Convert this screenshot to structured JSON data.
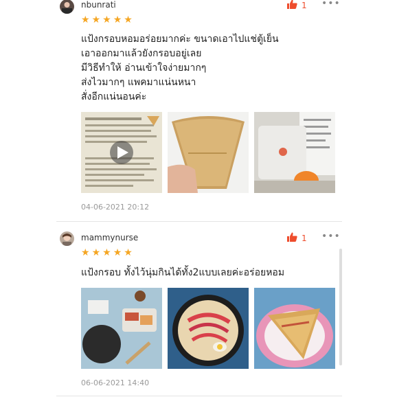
{
  "reviews": [
    {
      "username": "nbunrati",
      "likes": "1",
      "more": "•••",
      "rating": 5,
      "lines": [
        "แป้งกรอบหอมอร่อยมากค่ะ ขนาดเอาไปแช่ตู้เย็น",
        "เอาออกมาแล้วยังกรอบอยู่เลย",
        "มีวิธีทำให้ อ่านเข้าใจง่ายมากๆ",
        "ส่งไวมากๆ แพคมาแน่นหนา",
        "สั่งอีกแน่นอนค่ะ"
      ],
      "media": [
        "video-thumbnail-recipe-sheet",
        "photo-crepe-bag-in-hand",
        "photo-package-with-flyer"
      ],
      "date": "04-06-2021 20:12"
    },
    {
      "username": "mammynurse",
      "likes": "1",
      "more": "•••",
      "rating": 5,
      "lines": [
        "แป้งกรอบ ทั้งไว้นุ่มกินได้ทั้ง2แบบเลยค่ะอร่อยหอม"
      ],
      "media": [
        "photo-cooking-setup",
        "photo-crepe-with-toppings",
        "photo-folded-crepe-on-plate"
      ],
      "date": "06-06-2021 14:40"
    }
  ],
  "colors": {
    "accent": "#ee4d2d",
    "star": "#f5a623",
    "date": "#999999"
  },
  "icons": {
    "like": "thumbs-up-icon",
    "more": "more-icon",
    "play": "play-icon",
    "star": "star-icon"
  }
}
